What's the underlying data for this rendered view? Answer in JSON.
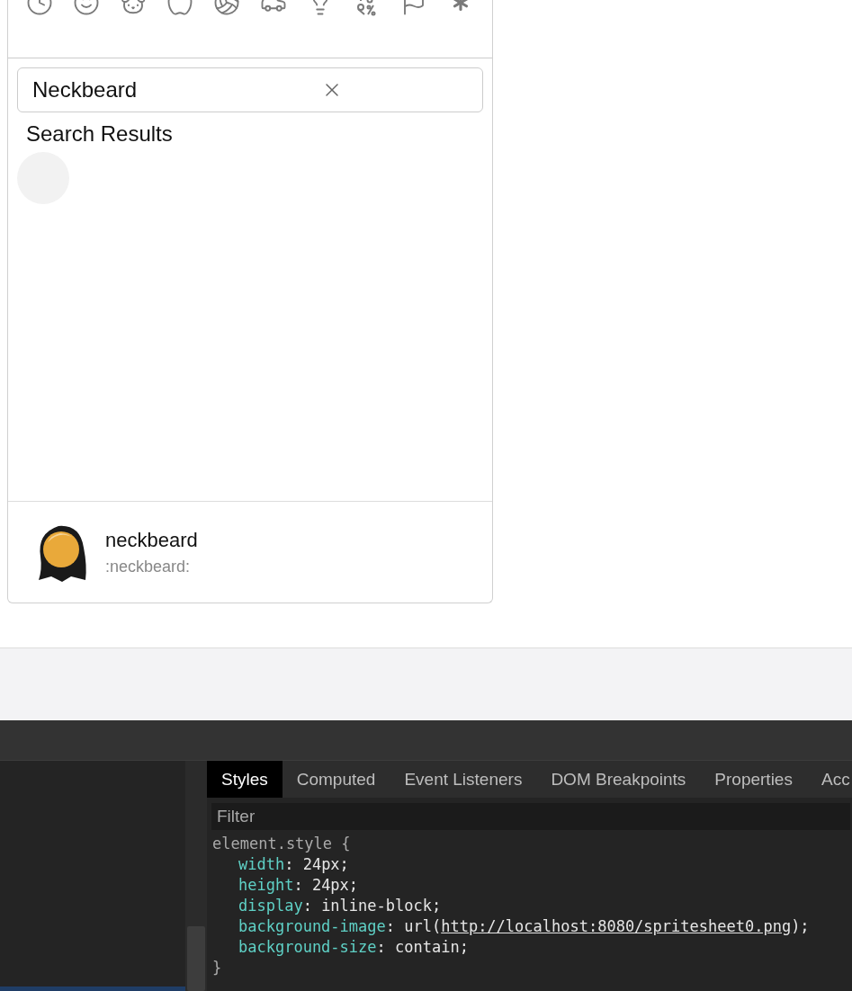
{
  "emoji_picker": {
    "categories": [
      {
        "kind": "clock"
      },
      {
        "kind": "smile"
      },
      {
        "kind": "dog"
      },
      {
        "kind": "apple"
      },
      {
        "kind": "ball"
      },
      {
        "kind": "car"
      },
      {
        "kind": "bulb"
      },
      {
        "kind": "symbols"
      },
      {
        "kind": "flag"
      },
      {
        "kind": "asterisk"
      }
    ],
    "search": {
      "value": "Neckbeard"
    },
    "results_title": "Search Results",
    "preview": {
      "name": "neckbeard",
      "code": ":neckbeard:"
    }
  },
  "devtools": {
    "tabs": [
      {
        "label": "Styles",
        "selected": true
      },
      {
        "label": "Computed",
        "selected": false
      },
      {
        "label": "Event Listeners",
        "selected": false
      },
      {
        "label": "DOM Breakpoints",
        "selected": false
      },
      {
        "label": "Properties",
        "selected": false
      },
      {
        "label": "Acc",
        "selected": false
      }
    ],
    "filter": {
      "placeholder": "Filter"
    },
    "rule": {
      "selector": "element.style {",
      "properties": [
        {
          "name": "width",
          "parts": [
            {
              "kind": "text",
              "text": ": 24px;"
            }
          ]
        },
        {
          "name": "height",
          "parts": [
            {
              "kind": "text",
              "text": ": 24px;"
            }
          ]
        },
        {
          "name": "display",
          "parts": [
            {
              "kind": "text",
              "text": ": inline-block;"
            }
          ]
        },
        {
          "name": "background-image",
          "parts": [
            {
              "kind": "text",
              "text": ": url("
            },
            {
              "kind": "link",
              "text": "http://localhost:8080/spritesheet0.png"
            },
            {
              "kind": "text",
              "text": ");"
            }
          ]
        },
        {
          "name": "background-size",
          "parts": [
            {
              "kind": "text",
              "text": ": contain;"
            }
          ]
        }
      ],
      "close": "}"
    }
  }
}
